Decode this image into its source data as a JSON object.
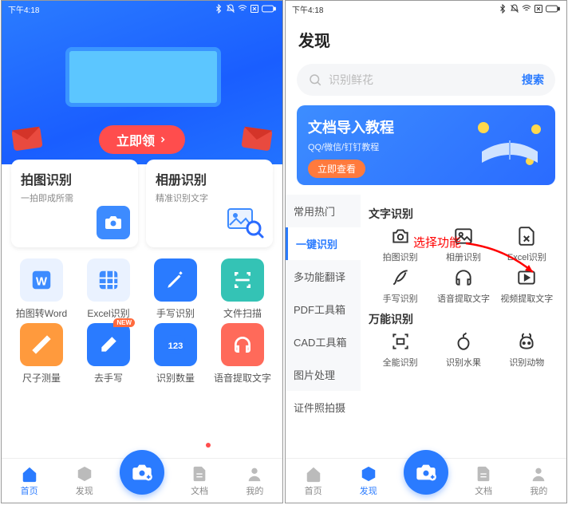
{
  "status_time": "下午4:18",
  "left": {
    "claim": "立即领",
    "big": [
      {
        "title": "拍图识别",
        "sub": "一拍即成所需"
      },
      {
        "title": "相册识别",
        "sub": "精准识别文字"
      }
    ],
    "grid": [
      {
        "label": "拍图转Word"
      },
      {
        "label": "Excel识别"
      },
      {
        "label": "手写识别"
      },
      {
        "label": "文件扫描"
      },
      {
        "label": "尺子测量"
      },
      {
        "label": "去手写",
        "badge": "NEW"
      },
      {
        "label": "识别数量"
      },
      {
        "label": "语音提取文字"
      }
    ],
    "nav": [
      "首页",
      "发现",
      "文档",
      "我的"
    ]
  },
  "right": {
    "title": "发现",
    "search_placeholder": "识别鲜花",
    "search_go": "搜索",
    "banner": {
      "title": "文档导入教程",
      "sub": "QQ/微信/钉钉教程",
      "btn": "立即查看"
    },
    "cats": [
      "常用热门",
      "一键识别",
      "多功能翻译",
      "PDF工具箱",
      "CAD工具箱",
      "图片处理",
      "证件照拍摄"
    ],
    "sec1": "文字识别",
    "sec2": "万能识别",
    "annotation": "选择功能",
    "row1": [
      {
        "l": "拍图识别"
      },
      {
        "l": "相册识别"
      },
      {
        "l": "Excel识别"
      }
    ],
    "row2": [
      {
        "l": "手写识别"
      },
      {
        "l": "语音提取文字"
      },
      {
        "l": "视频提取文字"
      }
    ],
    "row3": [
      {
        "l": "全能识别"
      },
      {
        "l": "识别水果"
      },
      {
        "l": "识别动物"
      }
    ],
    "nav": [
      "首页",
      "发现",
      "文档",
      "我的"
    ]
  }
}
